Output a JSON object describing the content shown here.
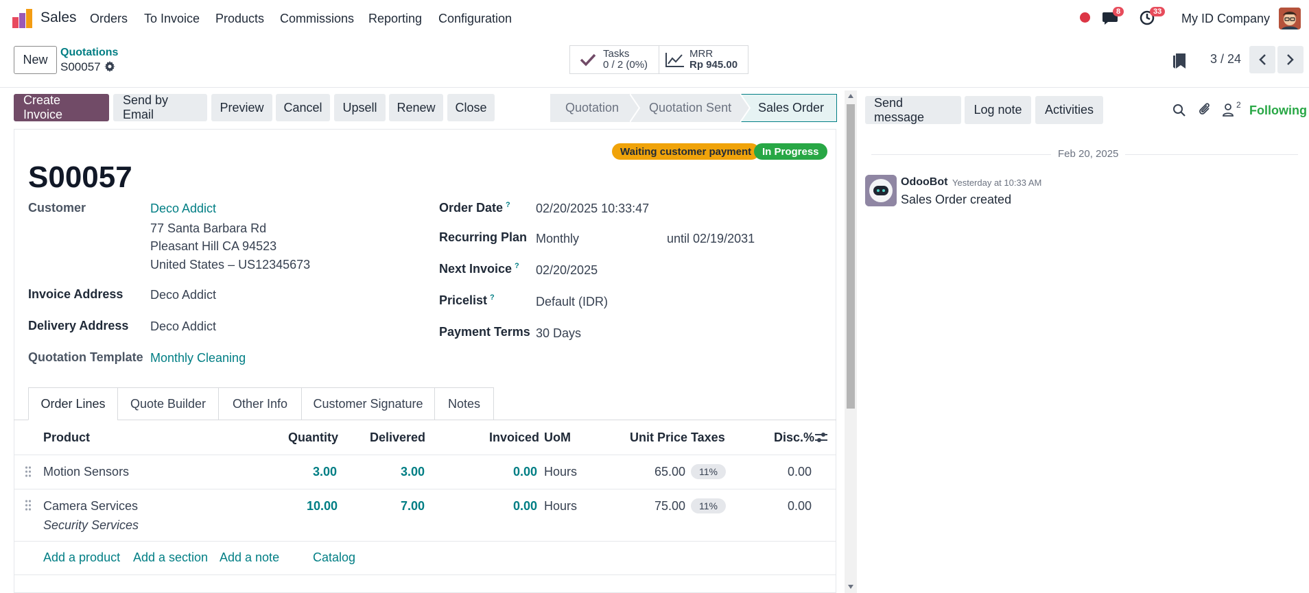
{
  "nav": {
    "app_name": "Sales",
    "menu": [
      "Orders",
      "To Invoice",
      "Products",
      "Commissions",
      "Reporting",
      "Configuration"
    ],
    "messages_count": "8",
    "activities_count": "33",
    "company": "My ID Company"
  },
  "control": {
    "new_label": "New",
    "breadcrumb_parent": "Quotations",
    "breadcrumb_current": "S00057",
    "tasks_label": "Tasks",
    "tasks_value": "0 / 2 (0%)",
    "mrr_label": "MRR",
    "mrr_value": "Rp 945.00",
    "pager": "3 / 24"
  },
  "actions": [
    "Create Invoice",
    "Send by Email",
    "Preview",
    "Cancel",
    "Upsell",
    "Renew",
    "Close"
  ],
  "stages": {
    "items": [
      "Quotation",
      "Quotation Sent",
      "Sales Order"
    ],
    "current": "Sales Order"
  },
  "form": {
    "badge_waiting": "Waiting customer payment",
    "badge_progress": "In Progress",
    "name": "S00057",
    "customer_label": "Customer",
    "customer_name": "Deco Addict",
    "address_line1": "77 Santa Barbara Rd",
    "address_line2": "Pleasant Hill CA 94523",
    "address_line3": "United States – US12345673",
    "invoice_address_label": "Invoice Address",
    "invoice_address": "Deco Addict",
    "delivery_address_label": "Delivery Address",
    "delivery_address": "Deco Addict",
    "template_label": "Quotation Template",
    "template_value": "Monthly Cleaning",
    "order_date_label": "Order Date",
    "order_date": "02/20/2025 10:33:47",
    "recurring_label": "Recurring Plan",
    "recurring_value": "Monthly",
    "recurring_until": "until 02/19/2031",
    "next_invoice_label": "Next Invoice",
    "next_invoice": "02/20/2025",
    "pricelist_label": "Pricelist",
    "pricelist": "Default (IDR)",
    "payment_terms_label": "Payment Terms",
    "payment_terms": "30 Days",
    "help_mark": "?"
  },
  "tabs": [
    "Order Lines",
    "Quote Builder",
    "Other Info",
    "Customer Signature",
    "Notes"
  ],
  "table": {
    "headers": [
      "Product",
      "Quantity",
      "Delivered",
      "Invoiced",
      "UoM",
      "Unit Price",
      "Taxes",
      "Disc.%"
    ],
    "rows": [
      {
        "product": "Motion Sensors",
        "description": "",
        "quantity": "3.00",
        "delivered": "3.00",
        "invoiced": "0.00",
        "uom": "Hours",
        "unit_price": "65.00",
        "taxes": "11%",
        "discount": "0.00"
      },
      {
        "product": "Camera Services",
        "description": "Security Services",
        "quantity": "10.00",
        "delivered": "7.00",
        "invoiced": "0.00",
        "uom": "Hours",
        "unit_price": "75.00",
        "taxes": "11%",
        "discount": "0.00"
      }
    ],
    "add_links": [
      "Add a product",
      "Add a section",
      "Add a note",
      "Catalog"
    ]
  },
  "chatter": {
    "send_message": "Send message",
    "log_note": "Log note",
    "activities": "Activities",
    "followers_count": "2",
    "following": "Following",
    "date": "Feb 20, 2025",
    "author": "OdooBot",
    "time": "Yesterday at 10:33 AM",
    "message": "Sales Order created"
  },
  "colors": {
    "primary": "#714b67",
    "link": "#017e84",
    "waiting": "#f0a30a",
    "progress": "#28a745",
    "following": "#28a745"
  }
}
